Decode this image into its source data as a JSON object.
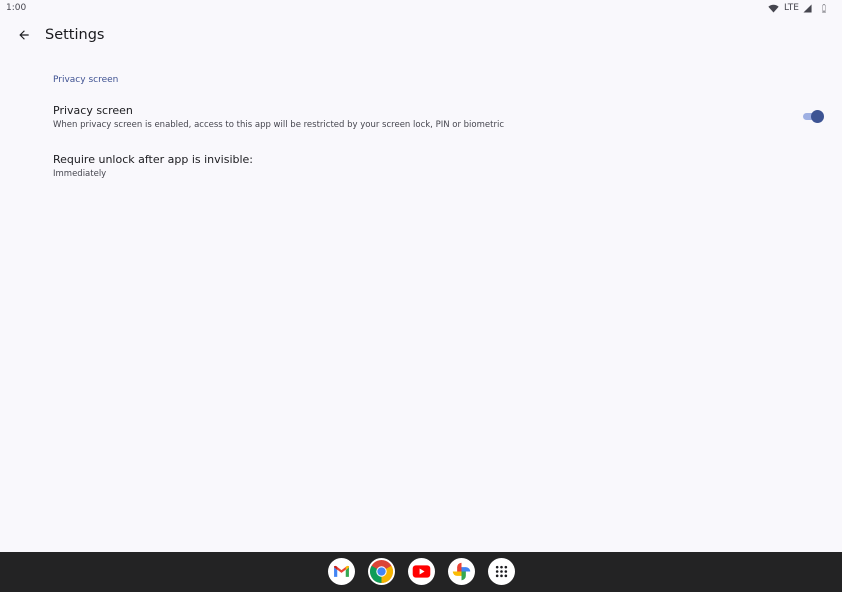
{
  "status_bar": {
    "time": "1:00",
    "network": "LTE",
    "icons": [
      "wifi-icon",
      "cell-signal-icon",
      "battery-icon"
    ]
  },
  "app_bar": {
    "title": "Settings",
    "back_icon": "arrow-back-icon"
  },
  "section": {
    "header": "Privacy screen"
  },
  "preferences": [
    {
      "title": "Privacy screen",
      "summary": "When privacy screen is enabled, access to this app will be restricted by your screen lock, PIN or biometric",
      "toggle_on": true
    },
    {
      "title": "Require unlock after app is invisible:",
      "summary": "Immediately"
    }
  ],
  "taskbar": {
    "apps": [
      "gmail-icon",
      "chrome-icon",
      "youtube-icon",
      "photos-icon",
      "app-drawer-icon"
    ]
  },
  "colors": {
    "background": "#f9f8fc",
    "accent": "#3d5494",
    "section_header": "#3f5292",
    "toggle_track": "#9fb0e3",
    "taskbar": "#232324"
  }
}
